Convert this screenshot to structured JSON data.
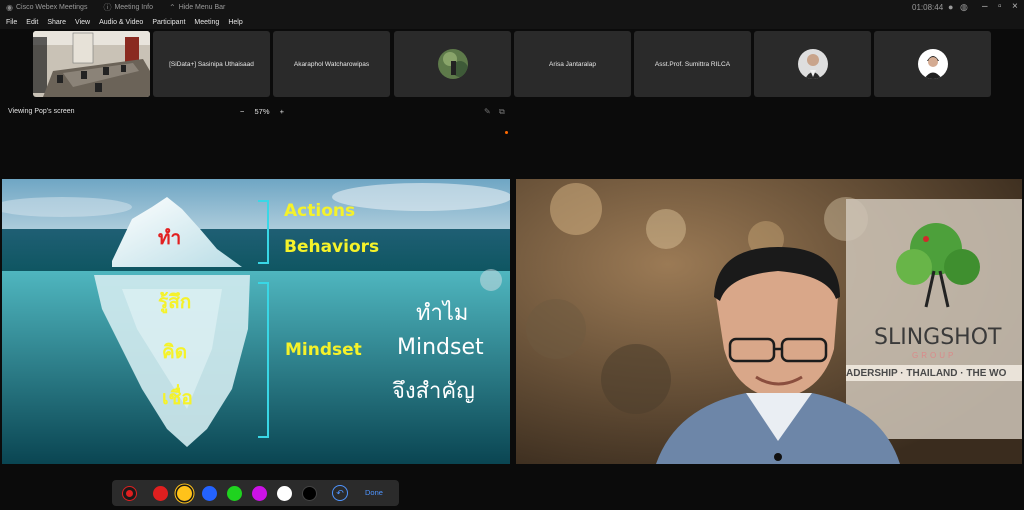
{
  "titlebar": {
    "items": [
      {
        "icon": "webex-logo-icon",
        "label": "Cisco Webex Meetings"
      },
      {
        "icon": "info-icon",
        "label": "Meeting Info"
      },
      {
        "icon": "hide-menu-icon",
        "label": "Hide Menu Bar"
      }
    ],
    "timer": "01:08:44"
  },
  "menu": [
    "File",
    "Edit",
    "Share",
    "View",
    "Audio & Video",
    "Participant",
    "Meeting",
    "Help"
  ],
  "participants": [
    {
      "name": "",
      "type": "video-room"
    },
    {
      "name": "[SiData+] Sasinipa Uthaisaad",
      "type": "name"
    },
    {
      "name": "Akaraphol Watcharowipas",
      "type": "name"
    },
    {
      "name": "",
      "type": "avatar-photo"
    },
    {
      "name": "Arisa Jantaralap",
      "type": "name"
    },
    {
      "name": "Asst.Prof. Sumittra RILCA",
      "type": "name"
    },
    {
      "name": "",
      "type": "avatar-photo"
    },
    {
      "name": "",
      "type": "avatar-photo"
    }
  ],
  "viewing": {
    "label": "Viewing Pop's screen",
    "zoom": "57%",
    "zoom_minus": "−",
    "zoom_plus": "+"
  },
  "slide": {
    "above_top": "Actions",
    "above_bottom": "Behaviors",
    "above_thai": "ทำ",
    "below_thai": [
      "รู้สึก",
      "คิด",
      "เชื่อ"
    ],
    "below_label": "Mindset",
    "question": [
      "ทำไม",
      "Mindset",
      "จึงสำคัญ"
    ]
  },
  "video": {
    "brand": "SLINGSHOT",
    "brand_sub": "GROUP",
    "banner": "ADERSHIP · THAILAND · THE WO"
  },
  "annotation": {
    "colors": [
      "#e01f1f",
      "#ffc21a",
      "#2463ff",
      "#1fd31f",
      "#cc12e6",
      "#ffffff",
      "#000000"
    ],
    "done_label": "Done"
  }
}
